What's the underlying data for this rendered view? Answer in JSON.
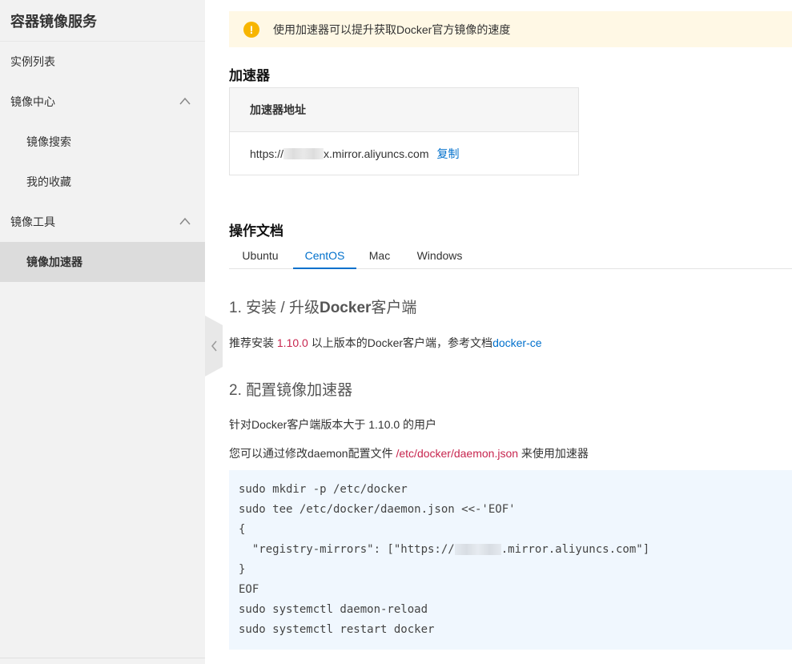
{
  "sidebar": {
    "title": "容器镜像服务",
    "items": [
      {
        "label": "实例列表"
      },
      {
        "label": "镜像中心"
      },
      {
        "label": "镜像搜索"
      },
      {
        "label": "我的收藏"
      },
      {
        "label": "镜像工具"
      },
      {
        "label": "镜像加速器"
      }
    ]
  },
  "notice": {
    "text": "使用加速器可以提升获取Docker官方镜像的速度"
  },
  "accelerator": {
    "title": "加速器",
    "header": "加速器地址",
    "url_prefix": "https://",
    "url_suffix": "x.mirror.aliyuncs.com",
    "copy_label": "复制"
  },
  "docs": {
    "title": "操作文档",
    "tabs": [
      {
        "label": "Ubuntu"
      },
      {
        "label": "CentOS"
      },
      {
        "label": "Mac"
      },
      {
        "label": "Windows"
      }
    ],
    "active_tab": "CentOS"
  },
  "step1": {
    "number": "1.",
    "title_a": "安装 / 升级",
    "title_b": "Docker",
    "title_c": "客户端",
    "text_a": "推荐安装 ",
    "version": "1.10.0",
    "text_b": " 以上版本的Docker客户端，参考文档",
    "link": "docker-ce"
  },
  "step2": {
    "number": "2.",
    "title": "配置镜像加速器",
    "line1": "针对Docker客户端版本大于 1.10.0 的用户",
    "line2_a": "您可以通过修改daemon配置文件 ",
    "line2_path": "/etc/docker/daemon.json",
    "line2_b": " 来使用加速器"
  },
  "code": {
    "l1": "sudo mkdir -p /etc/docker",
    "l2": "sudo tee /etc/docker/daemon.json <<-'EOF'",
    "l3": "{",
    "l4_a": "  \"registry-mirrors\": [\"https://",
    "l4_b": ".mirror.aliyuncs.com\"]",
    "l5": "}",
    "l6": "EOF",
    "l7": "sudo systemctl daemon-reload",
    "l8": "sudo systemctl restart docker"
  },
  "colors": {
    "accent": "#0070cc",
    "warning": "#f7b500",
    "highlight": "#c7254e",
    "code_bg": "#f0f7fe"
  }
}
